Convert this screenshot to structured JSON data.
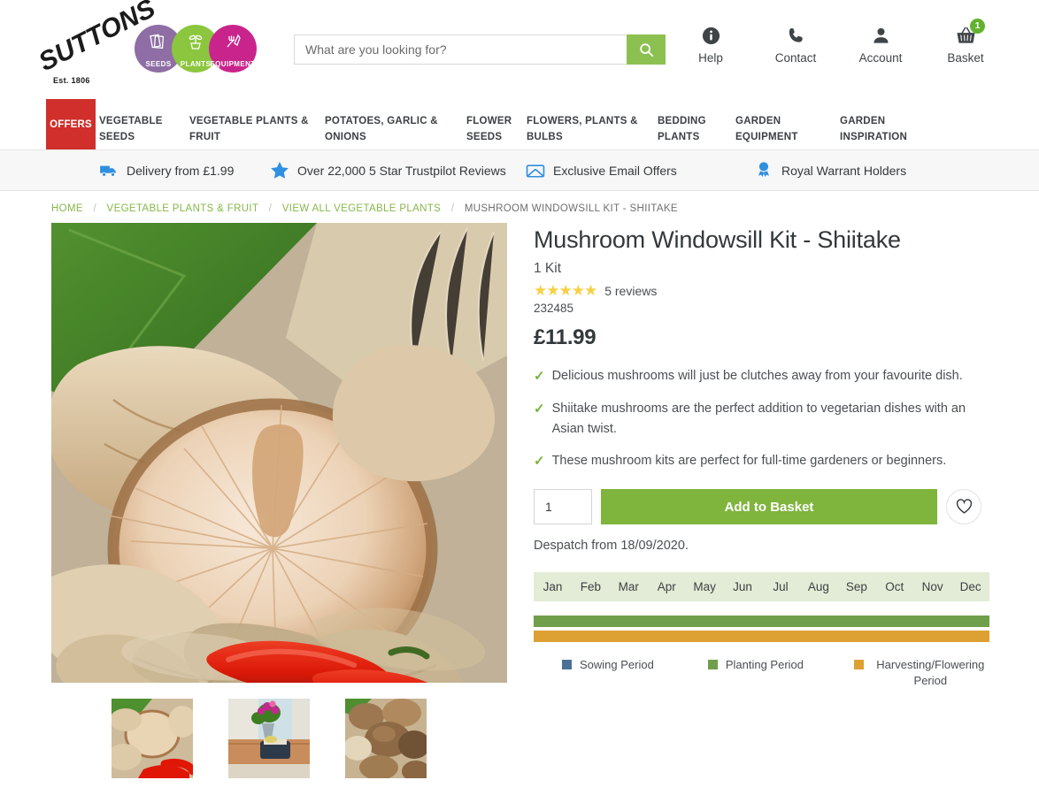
{
  "header": {
    "logo": {
      "word": "SUTTONS",
      "est": "Est. 1806",
      "badges": [
        {
          "label": "SEEDS",
          "color": "#8e6ea4",
          "icon": "seed-packets-icon"
        },
        {
          "label": "PLANTS",
          "color": "#8cc63e",
          "icon": "potted-plant-icon"
        },
        {
          "label": "EQUIPMENT",
          "color": "#c9248b",
          "icon": "fork-trowel-icon"
        }
      ]
    },
    "search": {
      "placeholder": "What are you looking for?",
      "value": ""
    },
    "actions": [
      {
        "label": "Help",
        "icon": "info-icon"
      },
      {
        "label": "Contact",
        "icon": "phone-icon"
      },
      {
        "label": "Account",
        "icon": "person-icon"
      },
      {
        "label": "Basket",
        "icon": "basket-icon",
        "badge": "1"
      }
    ]
  },
  "nav": {
    "offers": "OFFERS",
    "items": [
      {
        "line1": "VEGETABLE",
        "line2": "SEEDS"
      },
      {
        "line1": "VEGETABLE PLANTS &",
        "line2": "FRUIT"
      },
      {
        "line1": "POTATOES, GARLIC &",
        "line2": "ONIONS"
      },
      {
        "line1": "FLOWER",
        "line2": "SEEDS"
      },
      {
        "line1": "FLOWERS, PLANTS &",
        "line2": "BULBS"
      },
      {
        "line1": "BEDDING",
        "line2": "PLANTS"
      },
      {
        "line1": "GARDEN",
        "line2": "EQUIPMENT"
      },
      {
        "line1": "GARDEN",
        "line2": "INSPIRATION"
      }
    ]
  },
  "usp": [
    {
      "label": "Delivery from £1.99",
      "icon": "delivery-truck-icon"
    },
    {
      "label": "Over 22,000 5 Star Trustpilot Reviews",
      "icon": "star-icon"
    },
    {
      "label": "Exclusive Email Offers",
      "icon": "envelope-icon"
    },
    {
      "label": "Royal Warrant Holders",
      "icon": "award-medal-icon"
    }
  ],
  "breadcrumb": {
    "items": [
      "HOME",
      "VEGETABLE PLANTS & FRUIT",
      "VIEW ALL VEGETABLE PLANTS"
    ],
    "current": "MUSHROOM WINDOWSILL KIT - SHIITAKE"
  },
  "product": {
    "title": "Mushroom Windowsill Kit - Shiitake",
    "size": "1 Kit",
    "stars": "★★★★★",
    "reviews": "5 reviews",
    "sku": "232485",
    "price": "£11.99",
    "features": [
      "Delicious mushrooms will just be clutches away from your favourite dish.",
      "Shiitake mushrooms are the perfect addition to vegetarian dishes with an Asian twist.",
      "These mushroom kits are perfect for full-time gardeners or beginners."
    ],
    "quantity": "1",
    "add_to_basket": "Add to Basket",
    "wishlist_icon": "heart-icon",
    "despatch": "Despatch from 18/09/2020."
  },
  "calendar": {
    "months": [
      "Jan",
      "Feb",
      "Mar",
      "Apr",
      "May",
      "Jun",
      "Jul",
      "Aug",
      "Sep",
      "Oct",
      "Nov",
      "Dec"
    ],
    "bars": [
      {
        "type": "planting",
        "color": "#6f9f4a",
        "start": 1,
        "end": 12
      },
      {
        "type": "harvesting",
        "color": "#dda033",
        "start": 1,
        "end": 12
      }
    ],
    "legend": [
      {
        "label": "Sowing Period",
        "color": "#4a7296"
      },
      {
        "label": "Planting Period",
        "color": "#6f9f4a"
      },
      {
        "label": "Harvesting/Flowering Period",
        "color": "#dda033"
      }
    ]
  }
}
